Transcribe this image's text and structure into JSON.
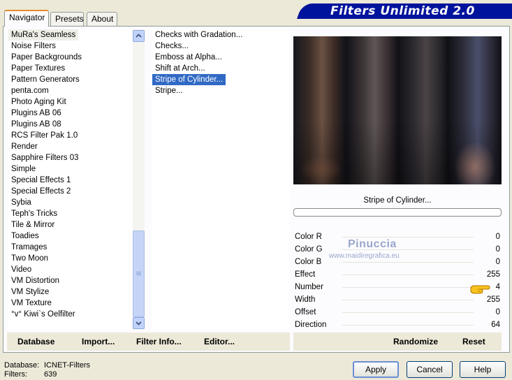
{
  "tabs": [
    {
      "label": "Navigator"
    },
    {
      "label": "Presets"
    },
    {
      "label": "About"
    }
  ],
  "title": "Filters Unlimited 2.0",
  "categories": [
    "MuRa's Seamless",
    "Noise Filters",
    "Paper Backgrounds",
    "Paper Textures",
    "Pattern Generators",
    "penta.com",
    "Photo Aging Kit",
    "Plugins AB 06",
    "Plugins AB 08",
    "RCS Filter Pak 1.0",
    "Render",
    "Sapphire Filters 03",
    "Simple",
    "Special Effects 1",
    "Special Effects 2",
    "Sybia",
    "Teph's Tricks",
    "Tile & Mirror",
    "Toadies",
    "Tramages",
    "Two Moon",
    "Video",
    "VM Distortion",
    "VM Stylize",
    "VM Texture",
    "°v° Kiwi`s Oelfilter"
  ],
  "filters": [
    "Checks with Gradation...",
    "Checks...",
    "Emboss at Alpha...",
    "Shift at Arch...",
    "Stripe of Cylinder...",
    "Stripe..."
  ],
  "preview_label": "Stripe of Cylinder...",
  "params": [
    {
      "label": "Color R",
      "value": "0"
    },
    {
      "label": "Color G",
      "value": "0"
    },
    {
      "label": "Color B",
      "value": "0"
    },
    {
      "label": "Effect",
      "value": "255"
    },
    {
      "label": "Number",
      "value": "4"
    },
    {
      "label": "Width",
      "value": "255"
    },
    {
      "label": "Offset",
      "value": "0"
    },
    {
      "label": "Direction",
      "value": "64"
    }
  ],
  "watermark": {
    "line1": "Pinuccia",
    "line2": "www.maidiregrafica.eu"
  },
  "bottom": {
    "database": "Database",
    "import": "Import...",
    "filter_info": "Filter Info...",
    "editor": "Editor...",
    "randomize": "Randomize",
    "reset": "Reset"
  },
  "status": {
    "database_label": "Database:",
    "database_value": "ICNET-Filters",
    "filters_label": "Filters:",
    "filters_value": "639"
  },
  "buttons": {
    "apply": "Apply",
    "cancel": "Cancel",
    "help": "Help"
  },
  "colors": {
    "title_bar": "#00139c",
    "selection": "#316ac5"
  },
  "icons": {
    "scroll_up": "chevron-up-icon",
    "scroll_down": "chevron-down-icon",
    "pointer": "pointing-hand-icon"
  }
}
